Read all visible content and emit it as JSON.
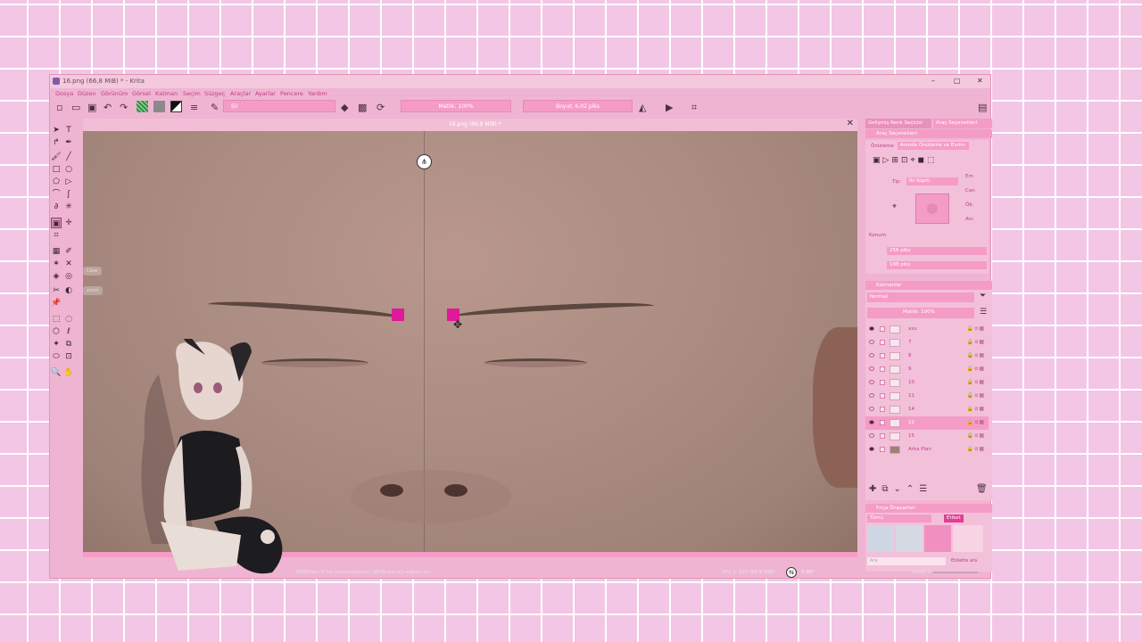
{
  "window": {
    "title": "16.png (66,8 MiB) * - Krita",
    "controls": {
      "minimize": "–",
      "maximize": "▢",
      "close": "✕"
    }
  },
  "menu": [
    "Dosya",
    "Düzen",
    "Görünüm",
    "Görsel",
    "Katman",
    "Seçim",
    "Süzgeç",
    "Araçlar",
    "Ayarlar",
    "Pencere",
    "Yardım"
  ],
  "toolbar": {
    "opacity_label": "Matlık: 100%",
    "size_label": "Boyut: 6,02 piks",
    "brush_preset": "Sil"
  },
  "document_tab": {
    "title": "16.png (66,8 MiB) *",
    "close": "✕"
  },
  "canvas_context": {
    "clear": "Clear",
    "zoom": "zoom"
  },
  "dockers": {
    "tabs": [
      "Gelişmiş Renk Seçicisi",
      "Araç Seçenekleri"
    ],
    "tool_options": {
      "title": "Araç Seçenekleri",
      "onizleme": "Önizleme",
      "preview_mode": "Anında Önizleme ve Evrim",
      "tip_label": "Tip:",
      "tip_value": "İki Küplü",
      "section": "Konum",
      "width": "256 piks",
      "height": "198 piks",
      "radio_options": [
        "Em",
        "Can",
        "Öb",
        "Anı"
      ]
    },
    "layers": {
      "title": "Katmanlar",
      "blend_mode": "Normal",
      "opacity": "Matlık: 100%",
      "items": [
        {
          "name": "xxx",
          "visible": true,
          "active": false
        },
        {
          "name": "7",
          "visible": false,
          "active": false
        },
        {
          "name": "8",
          "visible": false,
          "active": false
        },
        {
          "name": "9",
          "visible": false,
          "active": false
        },
        {
          "name": "10",
          "visible": false,
          "active": false
        },
        {
          "name": "11",
          "visible": false,
          "active": false
        },
        {
          "name": "14",
          "visible": false,
          "active": false
        },
        {
          "name": "12",
          "visible": true,
          "active": true
        },
        {
          "name": "15",
          "visible": false,
          "active": false
        },
        {
          "name": "Arka Plan",
          "visible": true,
          "active": false
        }
      ]
    },
    "brush_presets": {
      "title": "Fırça Önayarları",
      "filter": "Tümü",
      "tag": "Etiket",
      "search_placeholder": "Ara",
      "tag_filter": "Etikette ara"
    }
  },
  "statusbar": {
    "color_info": "RGB/Alfa (8 bit tamsayı/kanal) sRGB-elle-V2-srgbtrc.icc",
    "dimensions": "372 × 157 (66,8 MiB)",
    "rotation": "0,00°",
    "zoom": "%533,3"
  },
  "colors": {
    "accent": "#e0199a",
    "panel": "#efb4d1",
    "pink_field": "#f59cc6",
    "background": "#f3c6e6"
  }
}
